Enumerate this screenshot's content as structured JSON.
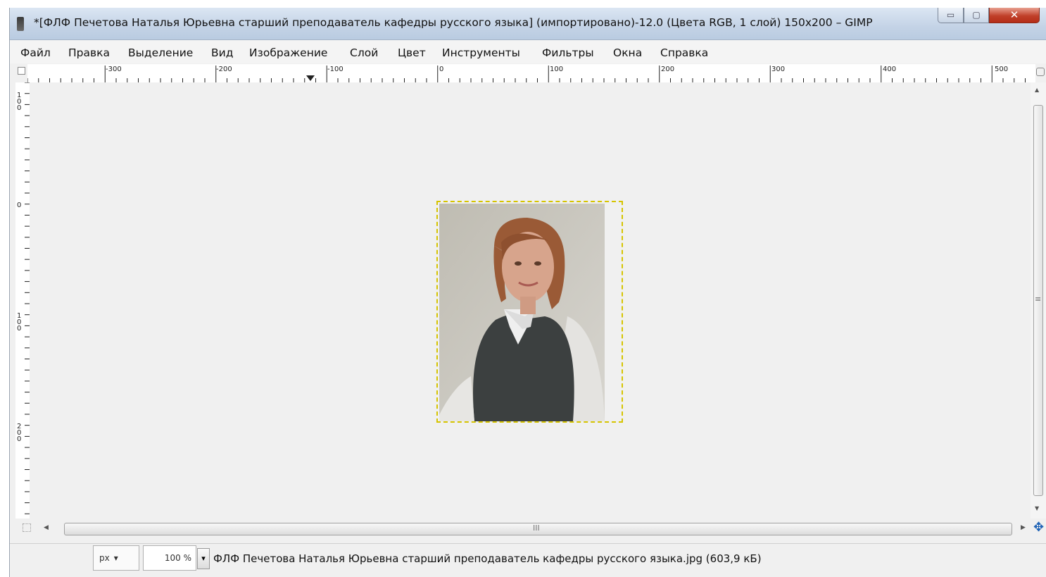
{
  "window": {
    "title": "*[ФЛФ Печетова Наталья Юрьевна старший преподаватель кафедры русского языка] (импортировано)-12.0 (Цвета RGB, 1 слой) 150x200 – GIMP"
  },
  "menubar": {
    "items": [
      {
        "label": "Файл"
      },
      {
        "label": "Правка"
      },
      {
        "label": "Выделение"
      },
      {
        "label": "Вид"
      },
      {
        "label": "Изображение"
      },
      {
        "label": "Слой"
      },
      {
        "label": "Цвет"
      },
      {
        "label": "Инструменты"
      },
      {
        "label": "Фильтры"
      },
      {
        "label": "Окна"
      },
      {
        "label": "Справка"
      }
    ]
  },
  "rulers": {
    "horizontal": [
      "-300",
      "-200",
      "-100",
      "0",
      "100",
      "200",
      "300",
      "400",
      "500"
    ],
    "vertical": [
      "100",
      "0",
      "100",
      "200"
    ]
  },
  "scrollbar": {
    "grip": "III",
    "vgrip": "≡"
  },
  "status": {
    "unit": "px",
    "zoom": "100 %",
    "file_info": "ФЛФ Печетова Наталья Юрьевна старший преподаватель кафедры русского языка.jpg (603,9 кБ)"
  },
  "icons": {
    "app": "gimp-icon",
    "navigate": "navigate-icon",
    "zoom": "zoom-icon",
    "pan": "move-icon"
  }
}
